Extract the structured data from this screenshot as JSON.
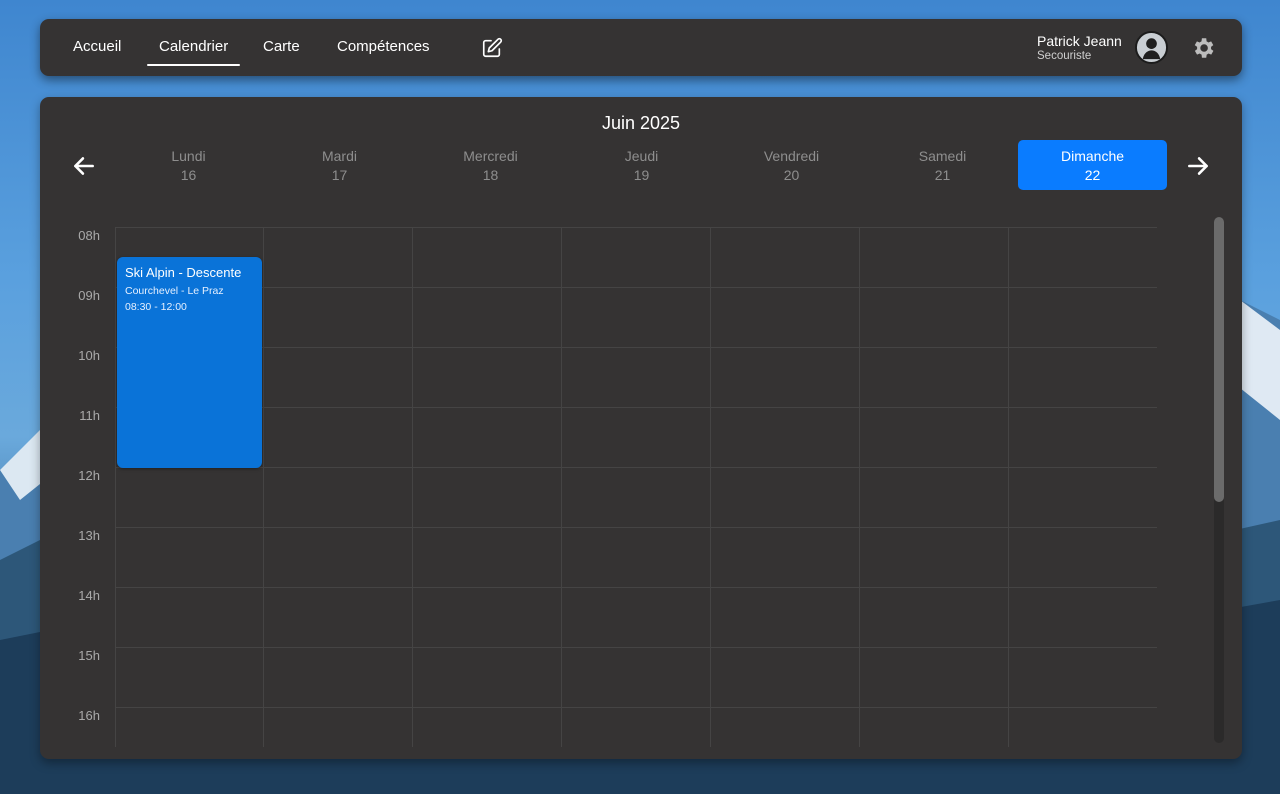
{
  "nav": {
    "items": [
      {
        "label": "Accueil"
      },
      {
        "label": "Calendrier",
        "active": true
      },
      {
        "label": "Carte"
      },
      {
        "label": "Compétences"
      }
    ],
    "edit_icon": "pencil-square-icon"
  },
  "user": {
    "name": "Patrick Jeann",
    "role": "Secouriste",
    "avatar_icon": "user-avatar-icon",
    "settings_icon": "gear-icon"
  },
  "calendar": {
    "month": "Juin 2025",
    "prev_icon": "arrow-left-icon",
    "next_icon": "arrow-right-icon",
    "days": [
      {
        "name": "Lundi",
        "date": "16"
      },
      {
        "name": "Mardi",
        "date": "17"
      },
      {
        "name": "Mercredi",
        "date": "18"
      },
      {
        "name": "Jeudi",
        "date": "19"
      },
      {
        "name": "Vendredi",
        "date": "20"
      },
      {
        "name": "Samedi",
        "date": "21"
      },
      {
        "name": "Dimanche",
        "date": "22",
        "selected": true
      }
    ],
    "hours": [
      "08h",
      "09h",
      "10h",
      "11h",
      "12h",
      "13h",
      "14h",
      "15h",
      "16h"
    ],
    "events": [
      {
        "title": "Ski Alpin - Descente",
        "location": "Courchevel - Le Praz",
        "time": "08:30 - 12:00",
        "day": "Lundi"
      }
    ]
  },
  "colors": {
    "accent": "#0a7cff",
    "event": "#0a73d8",
    "panel": "#353333"
  }
}
